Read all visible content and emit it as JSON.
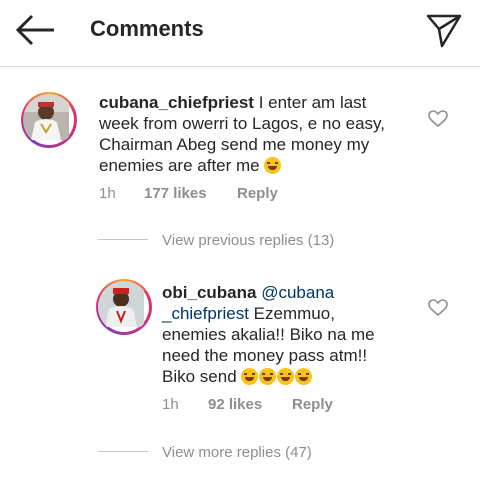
{
  "header": {
    "title": "Comments"
  },
  "comments": [
    {
      "username": "cubana_chiefpriest",
      "lines": [
        "I enter am last",
        "week from owerri to Lagos, e no easy,",
        "Chairman Abeg send me money my",
        "enemies are after me"
      ],
      "emojis": [
        "face-with-tears-of-joy"
      ],
      "time": "1h",
      "likes": "177 likes",
      "reply": "Reply",
      "view_replies": "View previous replies (13)"
    },
    {
      "username": "obi_cubana",
      "mention_line1": "@cubana",
      "mention_line2": "_chiefpriest",
      "lines": [
        "Ezemmuo,",
        "enemies akalia!! Biko na me",
        "need the money pass atm!!",
        "Biko send"
      ],
      "emojis": [
        "face-with-tears-of-joy",
        "rolling-on-floor-laughing",
        "rolling-on-floor-laughing",
        "rolling-on-floor-laughing"
      ],
      "time": "1h",
      "likes": "92 likes",
      "reply": "Reply",
      "view_replies": "View more replies (47)"
    }
  ]
}
